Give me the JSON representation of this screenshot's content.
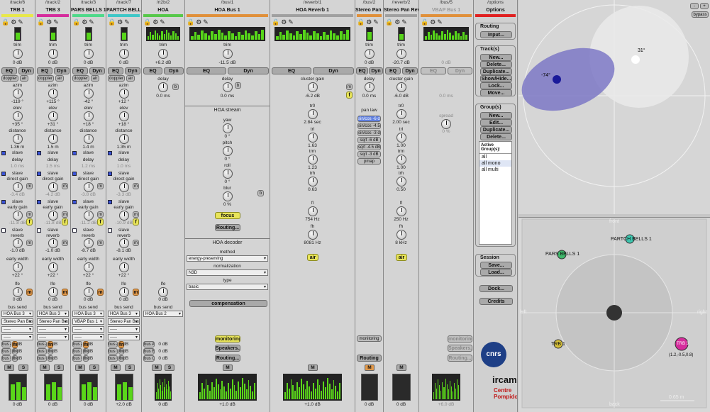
{
  "strips": [
    {
      "path": "/track/6",
      "name": "TRB 1",
      "color": "#e8e84a",
      "trim": "0 dB",
      "azim": "-119 °",
      "elev": "+35 °",
      "distance": "1.36 m",
      "delay": "1.0 ms",
      "dgain": "-3.4 dB",
      "egain": "-11.8 dB",
      "reverb": "-1.0 dB",
      "ewidth": "+22 °",
      "lfe": "0 dB",
      "bus": "HOA Bus 3",
      "bus2": "Stereo Pan Bus 1",
      "bus3": "-----",
      "bus4": "-----",
      "out": "0 dB"
    },
    {
      "path": "/track/2",
      "name": "TRB 3",
      "color": "#d52c9c",
      "trim": "0 dB",
      "azim": "+115 °",
      "elev": "+31 °",
      "distance": "1.5 m",
      "delay": "1.5 ms",
      "dgain": "-4.2 dB",
      "egain": "-11.8 dB",
      "reverb": "-1.0 dB",
      "ewidth": "+22 °",
      "lfe": "0 dB",
      "bus": "HOA Bus 3",
      "bus2": "Stereo Pan Bus 1",
      "bus3": "-----",
      "bus4": "-----",
      "out": "0 dB"
    },
    {
      "path": "/track/3",
      "name": "PARS BELLS 1",
      "color": "#4fd98a",
      "trim": "0 dB",
      "azim": "-42 °",
      "elev": "+18 °",
      "distance": "1.4 m",
      "delay": "1.2 ms",
      "dgain": "-3.8 dB",
      "egain": "-11.2 dB",
      "reverb": "-8.7 dB",
      "ewidth": "+22 °",
      "lfe": "0 dB",
      "bus": "HOA Bus 3",
      "bus2": "VBAP Bus 1",
      "bus3": "-----",
      "bus4": "-----",
      "out": "0 dB"
    },
    {
      "path": "/track/7",
      "name": "PARTCH BELLS 1",
      "color": "#3fc7c7",
      "trim": "0 dB",
      "azim": "+12 °",
      "elev": "+18 °",
      "distance": "1.35 m",
      "delay": "1.0 ms",
      "dgain": "-3.3 dB",
      "egain": "-10.9 dB",
      "reverb": "-8.1 dB",
      "ewidth": "+22 °",
      "lfe": "0 dB",
      "bus": "HOA Bus 3",
      "bus2": "Stereo Pan Bus 1",
      "bus3": "-----",
      "bus4": "-----",
      "out": "+2.0 dB"
    }
  ],
  "common": {
    "trim": "trim",
    "azim": "azim",
    "elev": "elev",
    "distance": "distance",
    "slave": "slave",
    "delay": "delay",
    "dgain": "direct gain",
    "egain": "early gain",
    "reverb": "reverb",
    "ewidth": "early width",
    "lfe": "lfe",
    "bussend": "bus send",
    "EQ": "EQ",
    "Dyn": "Dyn",
    "doppler": "doppler",
    "air": "air",
    "M": "M",
    "S": "S",
    "auxa": "bus A",
    "auxb": "bus B",
    "auxc": "bus C",
    "db0": "0 dB",
    "m": "m",
    "f": "f",
    "b": "b"
  },
  "hoa": {
    "path": "/rt2b/2",
    "name": "HOA",
    "trim": "+6.2 dB",
    "delay": "delay",
    "delayv": "0.0 ms",
    "lfe": "lfe",
    "lfev": "0 dB",
    "bus": "HOA Bus 2",
    "out": "0 dB"
  },
  "bus1": {
    "path": "/bus/1",
    "name": "HOA Bus 1",
    "trim": "-11.5 dB",
    "delay": "0.0 ms",
    "stream": "HOA stream",
    "yaw": "yaw",
    "yawv": "0 °",
    "pitch": "pitch",
    "pitchv": "0 °",
    "roll": "roll",
    "rollv": "0 °",
    "blur": "blur",
    "blurv": "0 %",
    "focus": "focus",
    "routing": "Routing...",
    "decoder": "HOA decoder",
    "method": "method",
    "methodv": "energy-preserving",
    "norm": "normalization",
    "normv": "N3D",
    "type": "type",
    "typev": "basic",
    "comp": "compensation",
    "monitoring": "monitoring",
    "speakers": "Speakers...",
    "routing2": "Routing...",
    "out": "+1.0 dB"
  },
  "reverb1": {
    "path": "/reverb/1",
    "name": "HOA Reverb 1",
    "cgain": "cluster gain",
    "cgainv": "-6.2 dB",
    "tr0": "tr0",
    "tr0v": "2.84 sec",
    "trl": "trl",
    "trlv": "1.63",
    "trm": "trm",
    "trmv": "1.23",
    "trh": "trh",
    "trhv": "0.63",
    "fl": "fl",
    "flv": "754 Hz",
    "fh": "fh",
    "fhv": "8081 Hz",
    "air": "air",
    "out": "+1.0 dB"
  },
  "bus2": {
    "path": "/bus/2",
    "name": "Stereo Pan B...",
    "trim": "0 dB",
    "delay": "0.0 ms",
    "panlaw": "pan law",
    "laws": [
      "sin/cos -6 dB",
      "sin/cos -4.5 dB",
      "sin/cos -3 dB",
      "sqrt -6 dB",
      "sqrt -4.5 dB",
      "sqrt -3 dB",
      "pmap"
    ],
    "monitoring": "monitoring",
    "routing": "Routing",
    "out": "0 dB"
  },
  "reverb2": {
    "path": "/reverb/2",
    "name": "Stereo Pan Reverb 1",
    "trim": "-20.7 dB",
    "cgainv": "-6.0 dB",
    "tr0v": "2.00 sec",
    "trlv": "1.00",
    "trmv": "1.00",
    "trhv": "0.50",
    "flv": "250 Hz",
    "fhv": "8 kHz",
    "air": "air",
    "out": "0 dB"
  },
  "bus5": {
    "path": "/bus/5",
    "name": "VBAP Bus 1",
    "trim": "0 dB",
    "delay": "0.0 ms",
    "spread": "spread",
    "spreadv": "0 %",
    "monitoring": "monitoring",
    "speakers": "Speakers...",
    "routing": "Routing...",
    "out": "+6.0 dB"
  },
  "options": {
    "path": "/options",
    "title": "Options",
    "routing": "Routing",
    "input": "Input...",
    "tracks": "Track(s)",
    "tnew": "New...",
    "tdelete": "Delete...",
    "tdup": "Duplicate...",
    "tshow": "Show/Hide...",
    "tlock": "Lock...",
    "tmove": "Move...",
    "groups": "Group(s)",
    "gnew": "New...",
    "gedit": "Edit...",
    "gdup": "Duplicate...",
    "gdel": "Delete...",
    "active": "Active Group(s):",
    "glist": [
      "all",
      "all mono",
      "all multi"
    ],
    "session": "Session",
    "save": "Save...",
    "load": "Load...",
    "dock": "Dock...",
    "credits": "Credits",
    "cnrs": "cnrs",
    "ircam": "ircam",
    "cp1": "Centre",
    "cp2": "Pompidou"
  },
  "disp1": {
    "left": "-74°",
    "right": "31°",
    "bypass": "bypass",
    "minus": "-",
    "plus": "+"
  },
  "disp2": {
    "front": "front",
    "back": "back",
    "leftw": "left",
    "rightw": "right",
    "scale": "0.65 m",
    "src": [
      {
        "label": "PARS BELLS 1",
        "color": "#3fb86b"
      },
      {
        "label": "PARTCH BELLS 1",
        "color": "#3fc7b0"
      },
      {
        "label": "TRB 1",
        "color": "#d8c23a"
      },
      {
        "label": "TRB 3",
        "color": "#d52c9c"
      }
    ],
    "coord": "(1.2,-0.5,0.8)"
  }
}
